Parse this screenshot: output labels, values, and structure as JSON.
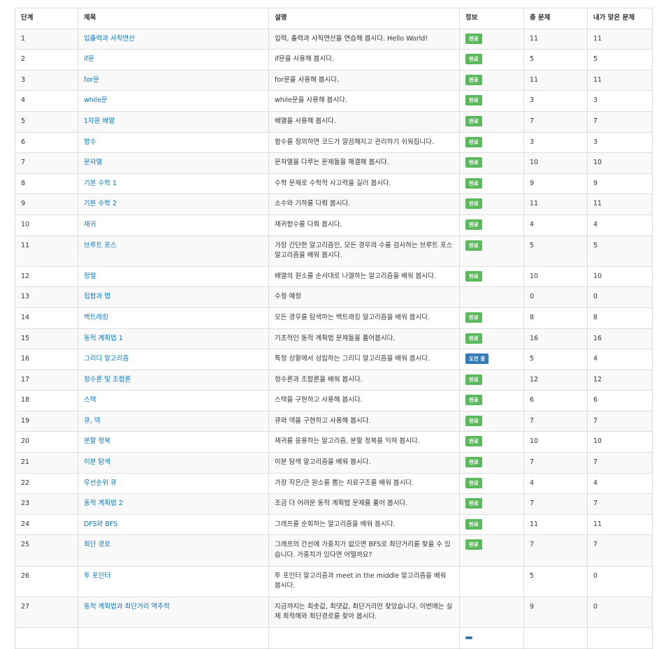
{
  "table": {
    "headers": {
      "step": "단계",
      "title": "제목",
      "description": "설명",
      "info": "정보",
      "total": "총 문제",
      "solved": "내가 맞은 문제"
    },
    "rows": [
      {
        "step": "1",
        "title": "입출력과 사칙연산",
        "description": "입력, 출력과 사칙연산을 연습해 봅시다. Hello World!",
        "status": "완료",
        "status_type": "success",
        "total": "11",
        "solved": "11"
      },
      {
        "step": "2",
        "title": "if문",
        "description": "if문을 사용해 봅시다.",
        "status": "완료",
        "status_type": "success",
        "total": "5",
        "solved": "5"
      },
      {
        "step": "3",
        "title": "for문",
        "description": "for문을 사용해 봅시다.",
        "status": "완료",
        "status_type": "success",
        "total": "11",
        "solved": "11"
      },
      {
        "step": "4",
        "title": "while문",
        "description": "while문을 사용해 봅시다.",
        "status": "완료",
        "status_type": "success",
        "total": "3",
        "solved": "3"
      },
      {
        "step": "5",
        "title": "1차원 배열",
        "description": "배열을 사용해 봅시다.",
        "status": "완료",
        "status_type": "success",
        "total": "7",
        "solved": "7"
      },
      {
        "step": "6",
        "title": "함수",
        "description": "함수를 정의하면 코드가 깔끔해지고 관리하기 쉬워집니다.",
        "status": "완료",
        "status_type": "success",
        "total": "3",
        "solved": "3"
      },
      {
        "step": "7",
        "title": "문자열",
        "description": "문자열을 다루는 문제들을 해결해 봅시다.",
        "status": "완료",
        "status_type": "success",
        "total": "10",
        "solved": "10"
      },
      {
        "step": "8",
        "title": "기본 수학 1",
        "description": "수학 문제로 수학적 사고력을 길러 봅시다.",
        "status": "완료",
        "status_type": "success",
        "total": "9",
        "solved": "9"
      },
      {
        "step": "9",
        "title": "기본 수학 2",
        "description": "소수와 기하를 다뤄 봅시다.",
        "status": "완료",
        "status_type": "success",
        "total": "11",
        "solved": "11"
      },
      {
        "step": "10",
        "title": "재귀",
        "description": "재귀함수를 다뤄 봅시다.",
        "status": "완료",
        "status_type": "success",
        "total": "4",
        "solved": "4"
      },
      {
        "step": "11",
        "title": "브루트 포스",
        "description": "가장 간단한 알고리즘인, 모든 경우의 수를 검사하는 브루트 포스 알고리즘을 배워 봅시다.",
        "status": "완료",
        "status_type": "success",
        "total": "5",
        "solved": "5"
      },
      {
        "step": "12",
        "title": "정렬",
        "description": "배열의 원소를 순서대로 나열하는 알고리즘을 배워 봅시다.",
        "status": "완료",
        "status_type": "success",
        "total": "10",
        "solved": "10"
      },
      {
        "step": "13",
        "title": "집합과 맵",
        "description": "수정 예정",
        "status": "",
        "status_type": "",
        "total": "0",
        "solved": "0"
      },
      {
        "step": "14",
        "title": "백트래킹",
        "description": "모든 경우를 탐색하는 백트래킹 알고리즘을 배워 봅시다.",
        "status": "완료",
        "status_type": "success",
        "total": "8",
        "solved": "8"
      },
      {
        "step": "15",
        "title": "동적 계획법 1",
        "description": "기초적인 동적 계획법 문제들을 풀어봅시다.",
        "status": "완료",
        "status_type": "success",
        "total": "16",
        "solved": "16"
      },
      {
        "step": "16",
        "title": "그리디 알고리즘",
        "description": "특정 상황에서 성립하는 그리디 알고리즘을 배워 봅시다.",
        "status": "도전 중",
        "status_type": "primary",
        "total": "5",
        "solved": "4"
      },
      {
        "step": "17",
        "title": "정수론 및 조합론",
        "description": "정수론과 조합론을 배워 봅시다.",
        "status": "완료",
        "status_type": "success",
        "total": "12",
        "solved": "12"
      },
      {
        "step": "18",
        "title": "스택",
        "description": "스택을 구현하고 사용해 봅시다.",
        "status": "완료",
        "status_type": "success",
        "total": "6",
        "solved": "6"
      },
      {
        "step": "19",
        "title": "큐, 덱",
        "description": "큐와 덱을 구현하고 사용해 봅시다.",
        "status": "완료",
        "status_type": "success",
        "total": "7",
        "solved": "7"
      },
      {
        "step": "20",
        "title": "분할 정복",
        "description": "재귀를 응용하는 알고리즘, 분할 정복을 익혀 봅시다.",
        "status": "완료",
        "status_type": "success",
        "total": "10",
        "solved": "10"
      },
      {
        "step": "21",
        "title": "이분 탐색",
        "description": "이분 탐색 알고리즘을 배워 봅시다.",
        "status": "완료",
        "status_type": "success",
        "total": "7",
        "solved": "7"
      },
      {
        "step": "22",
        "title": "우선순위 큐",
        "description": "가장 작은/큰 원소를 뽑는 자료구조를 배워 봅시다.",
        "status": "완료",
        "status_type": "success",
        "total": "4",
        "solved": "4"
      },
      {
        "step": "23",
        "title": "동적 계획법 2",
        "description": "조금 더 어려운 동적 계획법 문제를 풀어 봅시다.",
        "status": "완료",
        "status_type": "success",
        "total": "7",
        "solved": "7"
      },
      {
        "step": "24",
        "title": "DFS와 BFS",
        "description": "그래프를 순회하는 알고리즘을 배워 봅시다.",
        "status": "완료",
        "status_type": "success",
        "total": "11",
        "solved": "11"
      },
      {
        "step": "25",
        "title": "최단 경로",
        "description": "그래프의 간선에 가중치가 없으면 BFS로 최단거리를 찾을 수 있습니다. 가중치가 있다면 어떨까요?",
        "status": "완료",
        "status_type": "success",
        "total": "7",
        "solved": "7"
      },
      {
        "step": "26",
        "title": "투 포인터",
        "description": "투 포인터 알고리즘과 meet in the middle 알고리즘을 배워 봅시다.",
        "status": "",
        "status_type": "",
        "total": "5",
        "solved": "0"
      },
      {
        "step": "27",
        "title": "동적 계획법과 최단거리 역추적",
        "description": "지금까지는 최솟값, 최댓값, 최단거리만 찾았습니다. 이번에는 실제 최적해와 최단경로를 찾아 봅시다.",
        "status": "",
        "status_type": "",
        "total": "9",
        "solved": "0"
      },
      {
        "step": "",
        "title": "",
        "description": "",
        "status": "",
        "status_type": "primary",
        "total": "",
        "solved": ""
      }
    ]
  }
}
